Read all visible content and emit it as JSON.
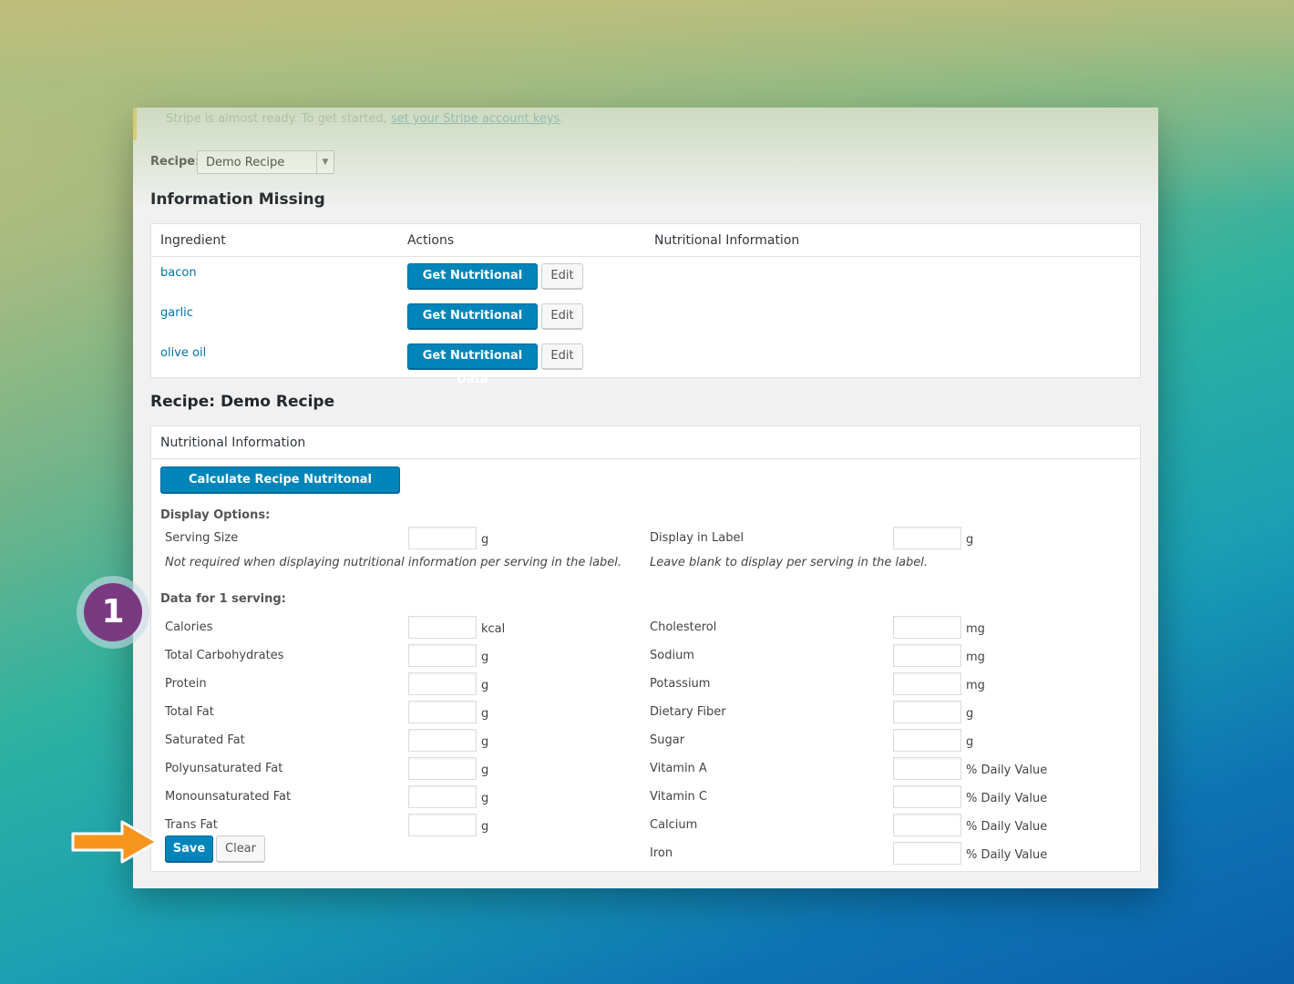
{
  "notice": {
    "text": "Stripe is almost ready. To get started, ",
    "link": "set your Stripe account keys",
    "end": "."
  },
  "recipe_select": {
    "label": "Recipe:",
    "value": "Demo Recipe"
  },
  "missing": {
    "title": "Information Missing",
    "headers": [
      "Ingredient",
      "Actions",
      "Nutritional Information"
    ],
    "rows": [
      {
        "name": "bacon",
        "get": "Get Nutritional Data",
        "edit": "Edit"
      },
      {
        "name": "garlic",
        "get": "Get Nutritional Data",
        "edit": "Edit"
      },
      {
        "name": "olive oil",
        "get": "Get Nutritional Data",
        "edit": "Edit"
      }
    ]
  },
  "recipe": {
    "title": "Recipe: Demo Recipe",
    "card_header": "Nutritional Information",
    "calc_button": "Calculate Recipe Nutritonal Information",
    "display_options": "Display Options:",
    "serving_size": {
      "label": "Serving Size",
      "unit": "g",
      "hint": "Not required when displaying nutritional information per serving in the label."
    },
    "display_in_label": {
      "label": "Display in Label",
      "unit": "g",
      "hint": "Leave blank to display per serving in the label."
    },
    "data_for": "Data for 1 serving:",
    "left_fields": [
      {
        "label": "Calories",
        "unit": "kcal"
      },
      {
        "label": "Total Carbohydrates",
        "unit": "g"
      },
      {
        "label": "Protein",
        "unit": "g"
      },
      {
        "label": "Total Fat",
        "unit": "g"
      },
      {
        "label": "Saturated Fat",
        "unit": "g"
      },
      {
        "label": "Polyunsaturated Fat",
        "unit": "g"
      },
      {
        "label": "Monounsaturated Fat",
        "unit": "g"
      },
      {
        "label": "Trans Fat",
        "unit": "g"
      }
    ],
    "right_fields": [
      {
        "label": "Cholesterol",
        "unit": "mg"
      },
      {
        "label": "Sodium",
        "unit": "mg"
      },
      {
        "label": "Potassium",
        "unit": "mg"
      },
      {
        "label": "Dietary Fiber",
        "unit": "g"
      },
      {
        "label": "Sugar",
        "unit": "g"
      },
      {
        "label": "Vitamin A",
        "unit": "% Daily Value"
      },
      {
        "label": "Vitamin C",
        "unit": "% Daily Value"
      },
      {
        "label": "Calcium",
        "unit": "% Daily Value"
      },
      {
        "label": "Iron",
        "unit": "% Daily Value"
      }
    ],
    "save": "Save",
    "clear": "Clear"
  },
  "step_badge": "1",
  "colors": {
    "primary": "#0085ba",
    "link": "#0073aa",
    "badge": "#7a3a82",
    "arrow": "#f7941d"
  }
}
